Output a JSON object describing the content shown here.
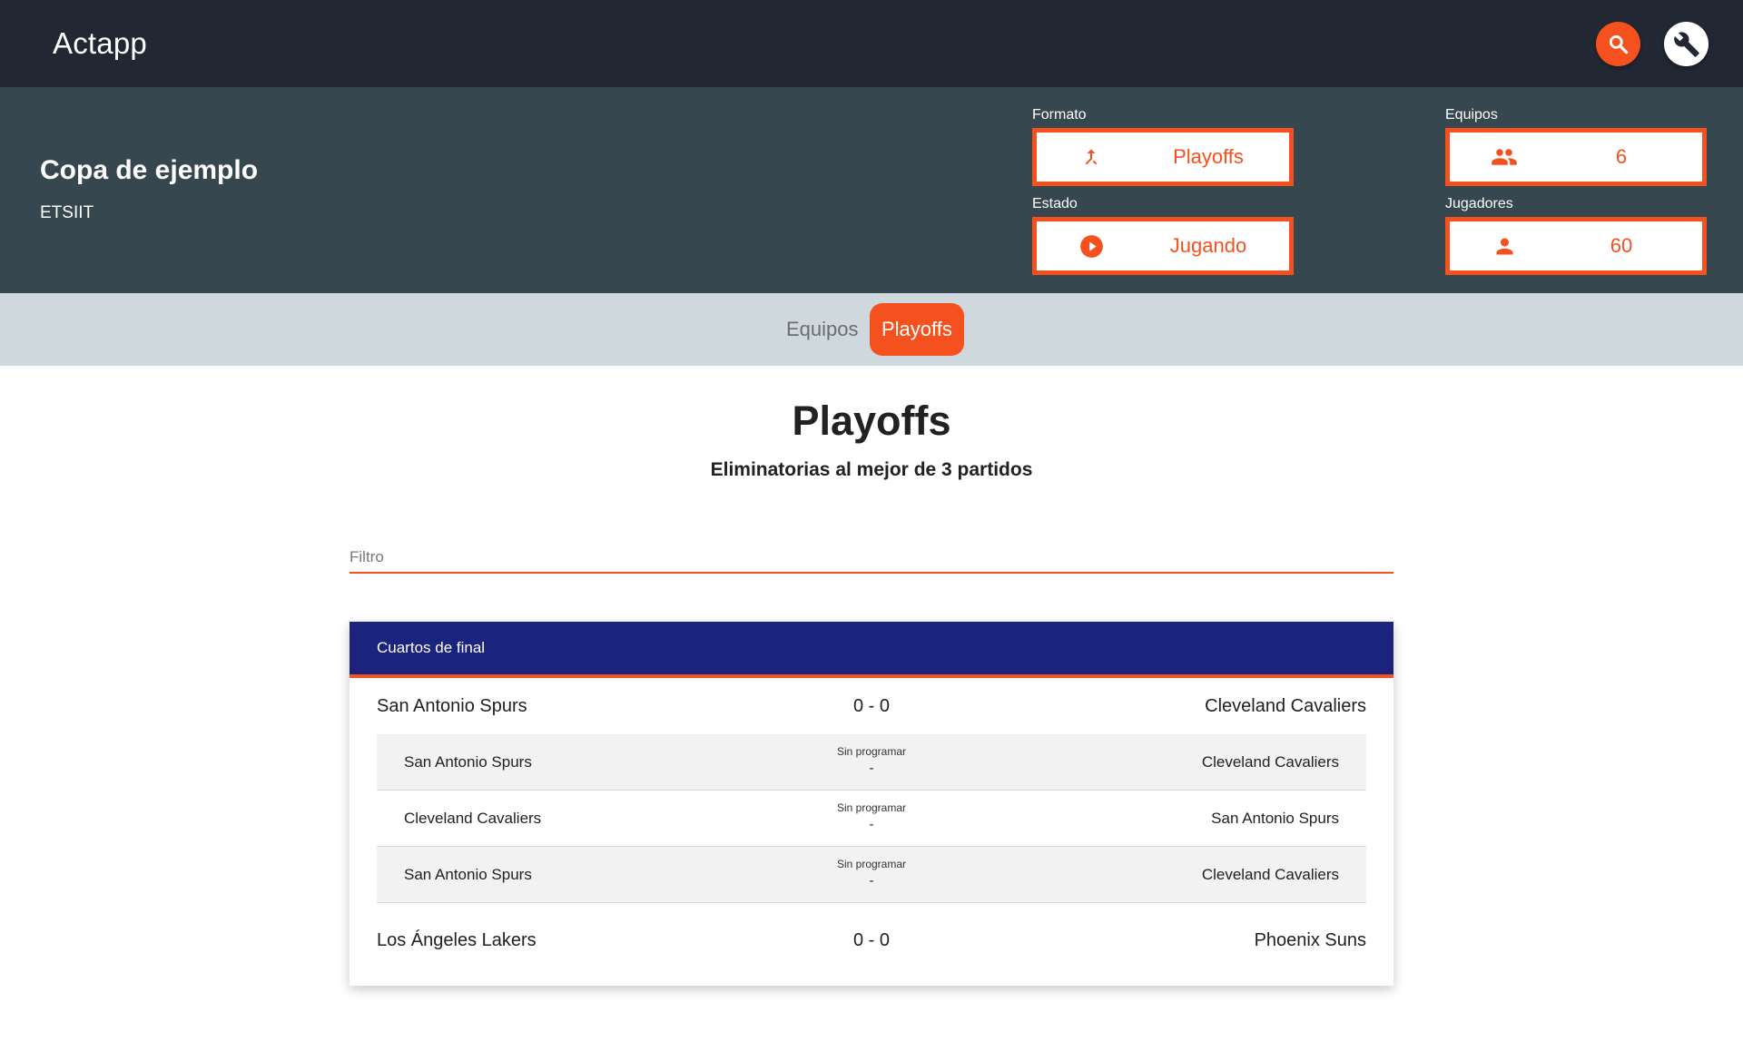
{
  "app": {
    "title": "Actapp"
  },
  "toolbar": {
    "search_icon": "search-icon",
    "tools_icon": "wrench-icon"
  },
  "colors": {
    "accent": "#f4511e",
    "topbar": "#212833",
    "header": "#37474f",
    "tabsbar": "#cfd8dc",
    "card_head": "#1a237e"
  },
  "competition": {
    "name": "Copa de ejemplo",
    "organizer": "ETSIIT"
  },
  "stats": {
    "formato": {
      "label": "Formato",
      "value": "Playoffs",
      "icon": "merge-icon"
    },
    "estado": {
      "label": "Estado",
      "value": "Jugando",
      "icon": "play-circle-icon"
    },
    "equipos": {
      "label": "Equipos",
      "value": "6",
      "icon": "group-icon"
    },
    "jugadores": {
      "label": "Jugadores",
      "value": "60",
      "icon": "person-icon"
    }
  },
  "tabs": [
    {
      "label": "Equipos"
    },
    {
      "label": "Playoffs",
      "active": true
    }
  ],
  "main": {
    "title": "Playoffs",
    "subtitle": "Eliminatorias al mejor de 3 partidos"
  },
  "filter": {
    "placeholder": "Filtro",
    "value": ""
  },
  "round": {
    "name": "Cuartos de final",
    "series": [
      {
        "home": "San Antonio Spurs",
        "score": "0 - 0",
        "away": "Cleveland Cavaliers",
        "games": [
          {
            "home": "San Antonio Spurs",
            "status": "Sin programar",
            "result": "-",
            "away": "Cleveland Cavaliers"
          },
          {
            "home": "Cleveland Cavaliers",
            "status": "Sin programar",
            "result": "-",
            "away": "San Antonio Spurs"
          },
          {
            "home": "San Antonio Spurs",
            "status": "Sin programar",
            "result": "-",
            "away": "Cleveland Cavaliers"
          }
        ]
      },
      {
        "home": "Los Ángeles Lakers",
        "score": "0 - 0",
        "away": "Phoenix Suns"
      }
    ]
  }
}
